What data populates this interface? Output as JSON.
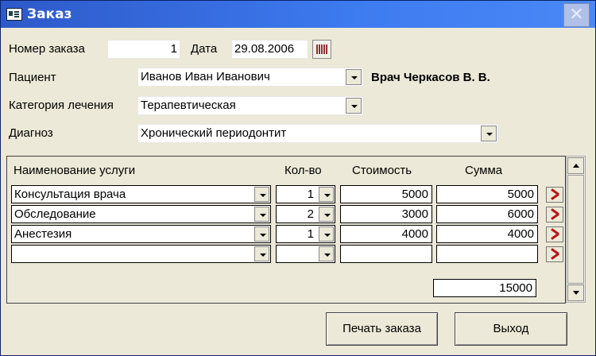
{
  "window": {
    "title": "Заказ",
    "close_glyph": "✕",
    "icon": "form-icon",
    "close_icon": "close-icon"
  },
  "form": {
    "order_number_label": "Номер заказа",
    "order_number_value": "1",
    "date_label": "Дата",
    "date_value": "29.08.2006",
    "date_picker_icon": "calendar-icon",
    "patient_label": "Пациент",
    "patient_value": "Иванов Иван Иванович",
    "doctor_text": "Врач Черкасов В. В.",
    "category_label": "Категория лечения",
    "category_value": "Терапевтическая",
    "diagnosis_label": "Диагноз",
    "diagnosis_value": "Хронический периодонтит"
  },
  "services": {
    "headers": {
      "name": "Наименование услуги",
      "qty": "Кол-во",
      "price": "Стоимость",
      "sum": "Сумма"
    },
    "rows": [
      {
        "name": "Консультация врача",
        "qty": "1",
        "price": "5000",
        "sum": "5000"
      },
      {
        "name": "Обследование",
        "qty": "2",
        "price": "3000",
        "sum": "6000"
      },
      {
        "name": "Анестезия",
        "qty": "1",
        "price": "4000",
        "sum": "4000"
      },
      {
        "name": "",
        "qty": "",
        "price": "",
        "sum": ""
      }
    ],
    "total": "15000",
    "delete_icon": "delete-row-icon"
  },
  "buttons": {
    "print": "Печать заказа",
    "exit": "Выход"
  }
}
